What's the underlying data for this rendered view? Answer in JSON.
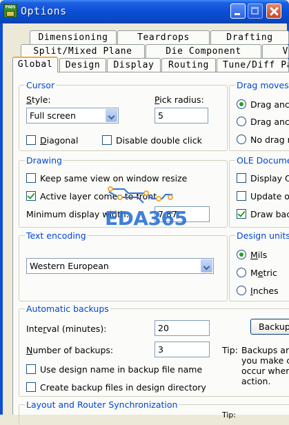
{
  "window": {
    "title": "Options",
    "app_icon_text": "PADS"
  },
  "tabs": {
    "row1": [
      "Dimensioning",
      "Teardrops",
      "Drafting"
    ],
    "row2": [
      "Split/Mixed Plane",
      "Die Component",
      "V"
    ],
    "row3": [
      "Global",
      "Design",
      "Display",
      "Routing",
      "Tune/Diff Pa"
    ],
    "active": "Global"
  },
  "cursor": {
    "title": "Cursor",
    "style_label": "Style:",
    "style_value": "Full screen",
    "pick_radius_label": "Pick radius:",
    "pick_radius_value": "5",
    "diagonal_label": "Diagonal",
    "diagonal_checked": false,
    "disable_dblclick_label": "Disable double click",
    "disable_dblclick_checked": false
  },
  "drag_moves": {
    "title": "Drag moves",
    "options": [
      "Drag anc",
      "Drag anc",
      "No drag r"
    ],
    "selected_index": 0
  },
  "drawing": {
    "title": "Drawing",
    "keep_same_view_label": "Keep same view on window resize",
    "keep_same_view_checked": false,
    "active_layer_label": "Active layer comes to front",
    "active_layer_checked": true,
    "min_width_label": "Minimum display width:",
    "min_width_value": "7.87"
  },
  "ole": {
    "title": "OLE Docume",
    "display_label": "Display O",
    "display_checked": false,
    "update_label": "Update o",
    "update_checked": false,
    "draw_bg_label": "Draw bac",
    "draw_bg_checked": true
  },
  "text_encoding": {
    "title": "Text encoding",
    "value": "Western European"
  },
  "design_units": {
    "title": "Design units",
    "options": [
      "Mils",
      "Metric",
      "Inches"
    ],
    "selected_index": 0
  },
  "backups": {
    "title": "Automatic backups",
    "interval_label": "Interval (minutes):",
    "interval_value": "20",
    "number_label": "Number of backups:",
    "number_value": "3",
    "use_name_label": "Use design name in backup file name",
    "use_name_checked": false,
    "create_dir_label": "Create backup files in design directory",
    "create_dir_checked": false,
    "backup_button": "Backup",
    "tip_label": "Tip:",
    "tip_text": [
      "Backups ar",
      "you make c",
      "occur when",
      "action."
    ]
  },
  "sync": {
    "title": "Layout and Router Synchronization",
    "tip_label": "Tip:"
  },
  "watermark": "EDA365",
  "colors": {
    "accent_orange": "#f1a93c",
    "group_label": "#0046d5",
    "check_green": "#21a121"
  }
}
